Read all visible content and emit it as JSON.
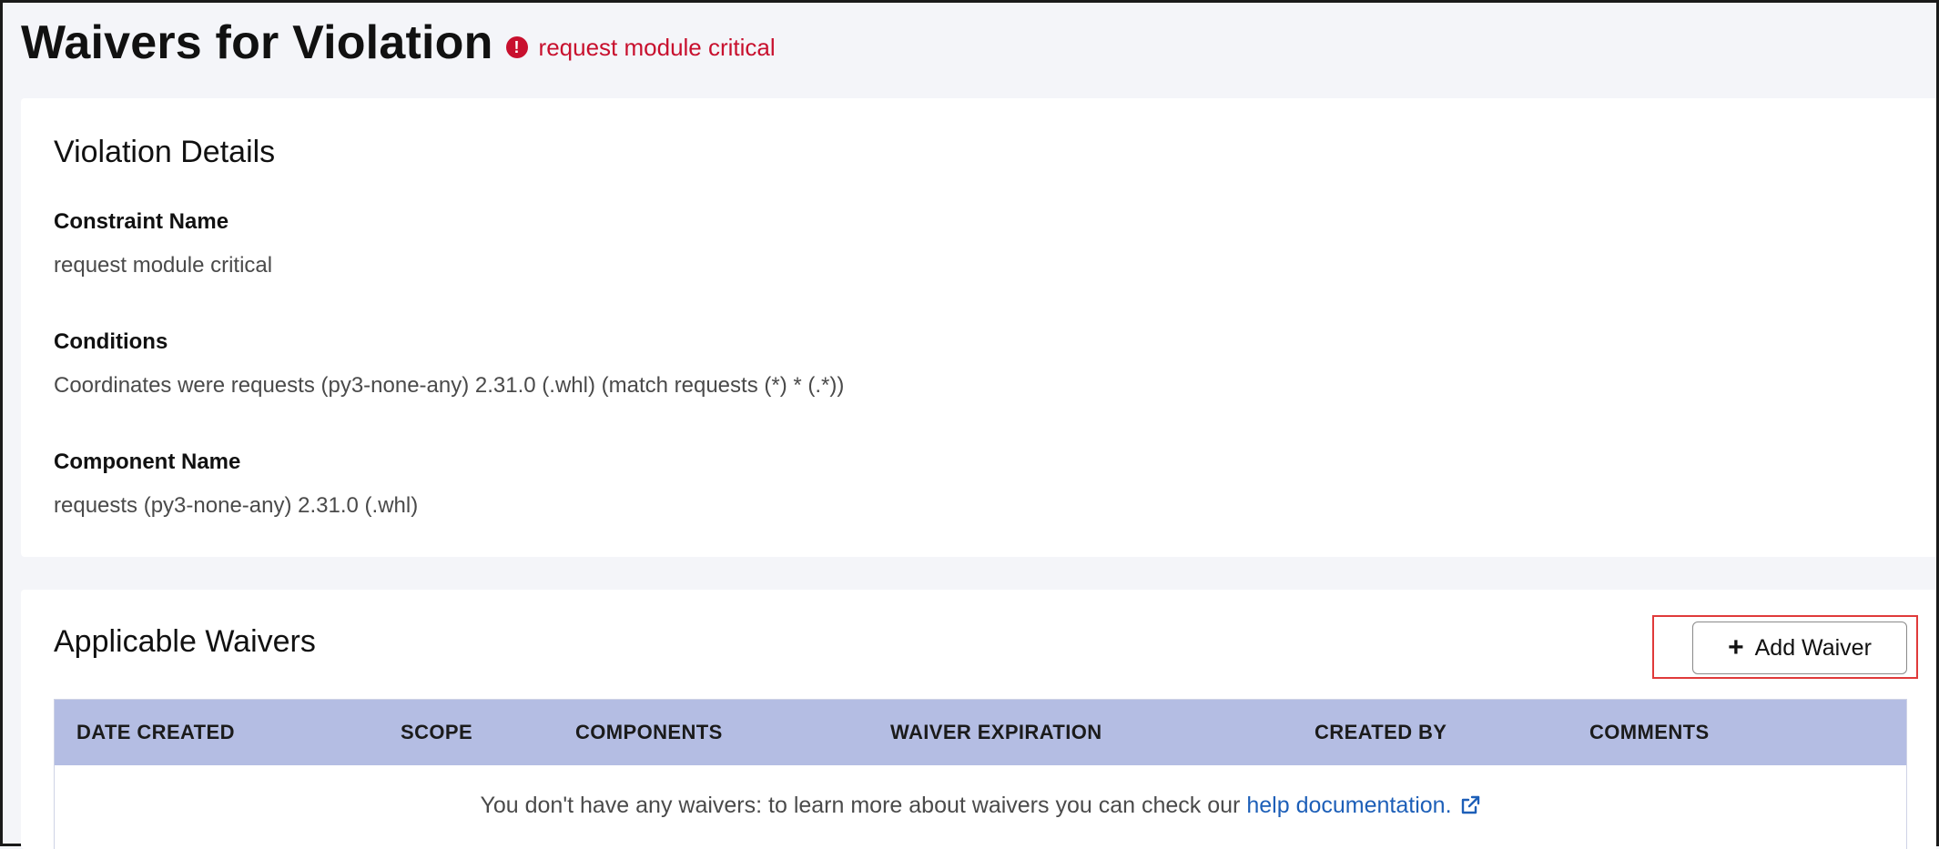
{
  "header": {
    "title": "Waivers for Violation",
    "violation_name": "request module critical",
    "alert_icon": "exclamation-circle-icon",
    "alert_color": "#c8102e"
  },
  "details": {
    "title": "Violation Details",
    "constraint_label": "Constraint Name",
    "constraint_value": "request module critical",
    "conditions_label": "Conditions",
    "conditions_value": "Coordinates were requests (py3-none-any) 2.31.0 (.whl) (match requests (*) * (.*))",
    "component_label": "Component Name",
    "component_value": "requests (py3-none-any) 2.31.0 (.whl)"
  },
  "waivers": {
    "title": "Applicable Waivers",
    "add_button_label": "Add Waiver",
    "add_button_icon": "plus-icon",
    "columns": [
      "DATE CREATED",
      "SCOPE",
      "COMPONENTS",
      "WAIVER EXPIRATION",
      "CREATED BY",
      "COMMENTS"
    ],
    "empty_text": "You don't have any waivers: to learn more about waivers you can check our",
    "help_link": "help documentation.",
    "help_icon": "external-link-icon",
    "header_color": "#b4bde3"
  }
}
